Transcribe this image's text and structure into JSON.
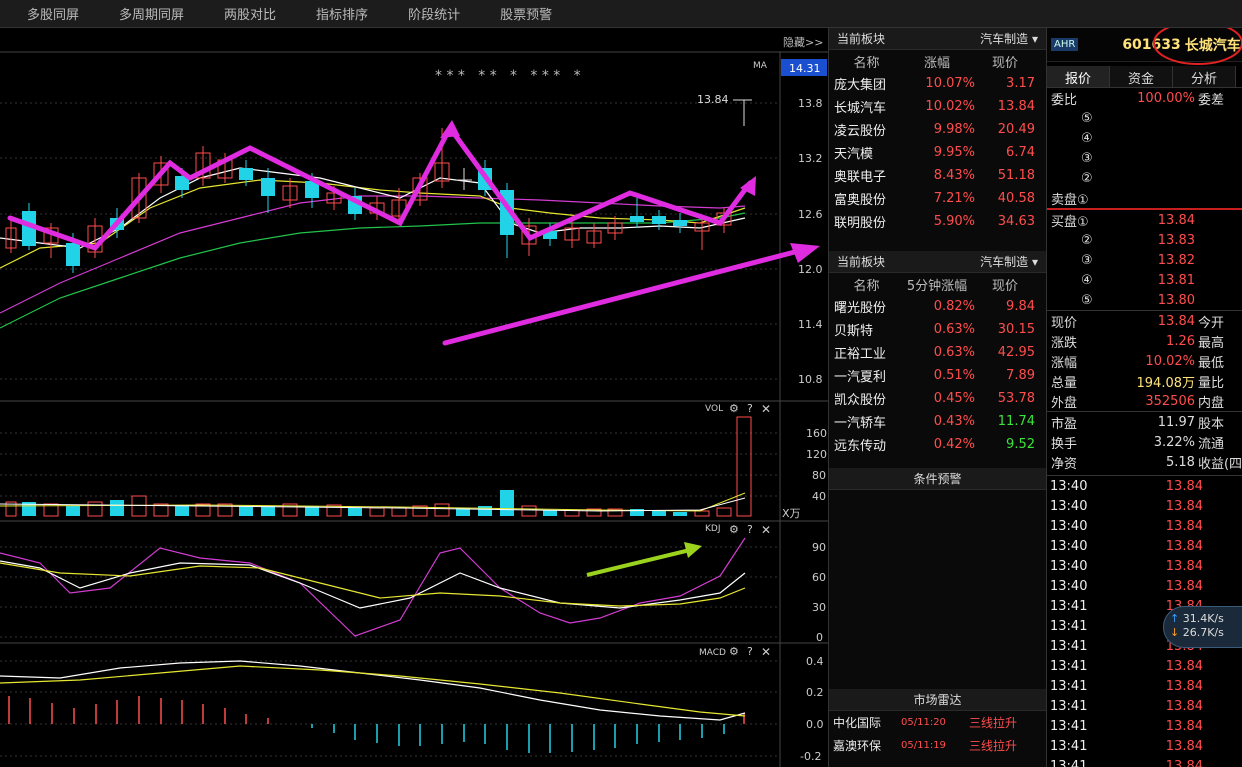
{
  "topbar": {
    "tabs": [
      "多股同屏",
      "多周期同屏",
      "两股对比",
      "指标排序",
      "阶段统计",
      "股票预警"
    ]
  },
  "chart": {
    "hide_label": "隐藏>>",
    "current_price_tag": "14.31",
    "ma_label": "MA",
    "last_marker": "13.84",
    "price_axis": [
      "13.8",
      "13.2",
      "12.6",
      "12.0",
      "11.4",
      "10.8"
    ],
    "vol_label": "VOL",
    "vol_axis": [
      "160",
      "120",
      "80",
      "40"
    ],
    "vol_unit": "X万",
    "kdj_label": "KDJ",
    "kdj_axis": [
      "90",
      "60",
      "30",
      "0"
    ],
    "macd_label": "MACD",
    "macd_axis": [
      "0.4",
      "0.2",
      "0.0",
      "-0.2"
    ],
    "stars": "* * *   * *   *   * * *   *"
  },
  "sector1": {
    "title": "当前板块",
    "dropdown": "汽车制造 ▾",
    "cols": [
      "名称",
      "涨幅",
      "现价"
    ],
    "rows": [
      [
        "庞大集团",
        "10.07%",
        "3.17"
      ],
      [
        "长城汽车",
        "10.02%",
        "13.84"
      ],
      [
        "凌云股份",
        "9.98%",
        "20.49"
      ],
      [
        "天汽模",
        "9.95%",
        "6.74"
      ],
      [
        "奥联电子",
        "8.43%",
        "51.18"
      ],
      [
        "富奥股份",
        "7.21%",
        "40.58"
      ],
      [
        "联明股份",
        "5.90%",
        "34.63"
      ]
    ]
  },
  "sector2": {
    "title": "当前板块",
    "dropdown": "汽车制造 ▾",
    "cols": [
      "名称",
      "5分钟涨幅",
      "现价"
    ],
    "rows": [
      [
        "曙光股份",
        "0.82%",
        "9.84"
      ],
      [
        "贝斯特",
        "0.63%",
        "30.15"
      ],
      [
        "正裕工业",
        "0.63%",
        "42.95"
      ],
      [
        "一汽夏利",
        "0.51%",
        "7.89"
      ],
      [
        "凯众股份",
        "0.45%",
        "53.78"
      ],
      [
        "一汽轿车",
        "0.43%",
        "11.74"
      ],
      [
        "远东传动",
        "0.42%",
        "9.52"
      ]
    ]
  },
  "alert": {
    "title": "条件预警"
  },
  "radar": {
    "title": "市场雷达",
    "rows": [
      [
        "中化国际",
        "05/11:20",
        "三线拉升"
      ],
      [
        "嘉澳环保",
        "05/11:19",
        "三线拉升"
      ]
    ]
  },
  "stock": {
    "badge": "AHR",
    "code": "601633",
    "name": "长城汽车"
  },
  "rtabs": [
    "报价",
    "资金",
    "分析"
  ],
  "quote": {
    "weibi": [
      "委比",
      "100.00%",
      "委差"
    ],
    "sell": [
      "⑤",
      "④",
      "③",
      "②",
      "卖盘①"
    ],
    "buy": [
      [
        "买盘①",
        "13.84"
      ],
      [
        "②",
        "13.83"
      ],
      [
        "③",
        "13.82"
      ],
      [
        "④",
        "13.81"
      ],
      [
        "⑤",
        "13.80"
      ]
    ],
    "stats": [
      [
        "现价",
        "13.84",
        "今开"
      ],
      [
        "涨跌",
        "1.26",
        "最高"
      ],
      [
        "涨幅",
        "10.02%",
        "最低"
      ],
      [
        "总量",
        "194.08万",
        "量比"
      ],
      [
        "外盘",
        "352506",
        "内盘"
      ]
    ],
    "stats2": [
      [
        "市盈",
        "11.97",
        "股本"
      ],
      [
        "换手",
        "3.22%",
        "流通"
      ],
      [
        "净资",
        "5.18",
        "收益(四"
      ]
    ]
  },
  "ticks": [
    [
      "13:40",
      "13.84"
    ],
    [
      "13:40",
      "13.84"
    ],
    [
      "13:40",
      "13.84"
    ],
    [
      "13:40",
      "13.84"
    ],
    [
      "13:40",
      "13.84"
    ],
    [
      "13:40",
      "13.84"
    ],
    [
      "13:41",
      "13.84"
    ],
    [
      "13:41",
      "13.84"
    ],
    [
      "13:41",
      "13.84"
    ],
    [
      "13:41",
      "13.84"
    ],
    [
      "13:41",
      "13.84"
    ],
    [
      "13:41",
      "13.84"
    ],
    [
      "13:41",
      "13.84"
    ],
    [
      "13:41",
      "13.84"
    ],
    [
      "13:41",
      "13.84"
    ]
  ],
  "net": {
    "up": "31.4K/s",
    "down": "26.7K/s"
  }
}
